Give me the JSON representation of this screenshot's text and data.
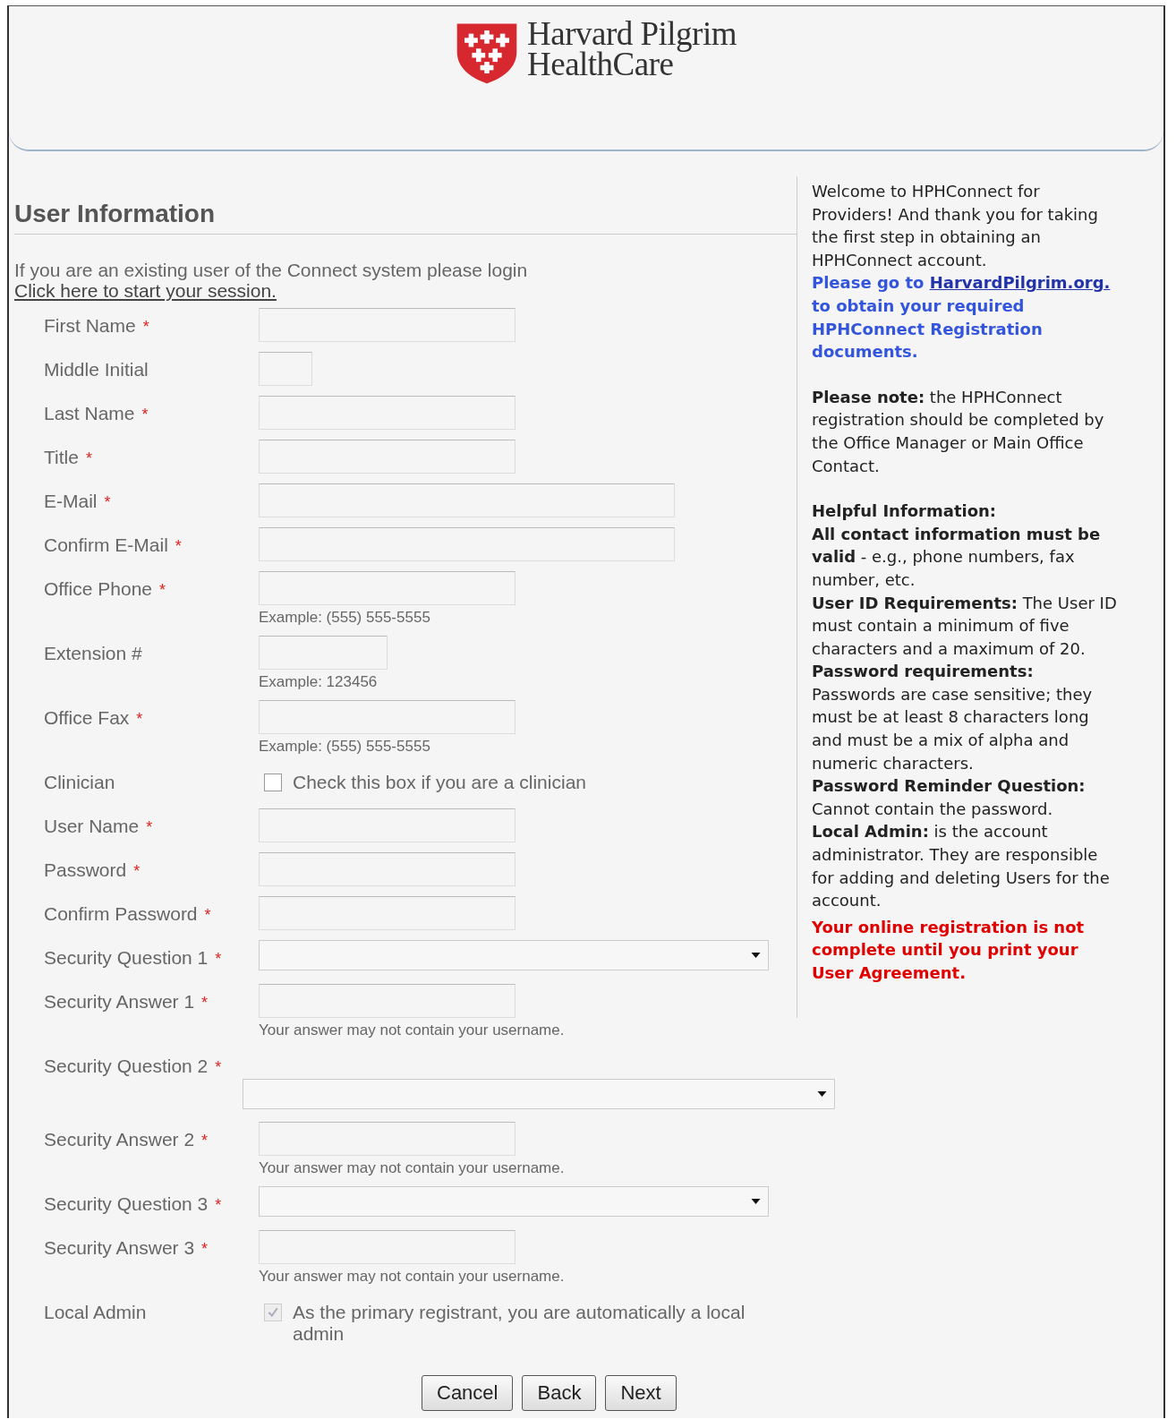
{
  "header": {
    "logo_lines": [
      "Harvard Pilgrim",
      "HealthCare"
    ]
  },
  "form": {
    "title": "User Information",
    "intro": {
      "text": "If you are an existing user of the Connect system please login",
      "link": "Click here to start your session."
    },
    "fields": [
      {
        "label": "First Name",
        "marker": "*",
        "kind": "text"
      },
      {
        "label": "Middle Initial",
        "kind": "text"
      },
      {
        "label": "Last Name",
        "marker": "*",
        "kind": "text"
      },
      {
        "label": "Title",
        "marker": "*",
        "kind": "text"
      },
      {
        "label": "E-Mail",
        "marker": "*",
        "kind": "text"
      },
      {
        "label": "Confirm E-Mail",
        "marker": "*",
        "kind": "text"
      },
      {
        "label": "Office Phone",
        "marker": "*",
        "kind": "text",
        "hint": "Example: (555) 555-5555"
      },
      {
        "label": "Extension #",
        "kind": "text",
        "hint": "Example: 123456"
      },
      {
        "label": "Office Fax",
        "marker": "*",
        "kind": "text",
        "hint": "Example: (555) 555-5555"
      },
      {
        "label": "Clinician",
        "kind": "checkbox",
        "text": "Check this box if you are a clinician",
        "checked": false,
        "disabled": false
      },
      {
        "label": "User Name",
        "marker": "*",
        "kind": "text"
      },
      {
        "label": "Password",
        "marker": "*",
        "kind": "text"
      },
      {
        "label": "Confirm Password",
        "marker": "*",
        "kind": "text"
      },
      {
        "label": "Security Question 1",
        "marker": "*",
        "kind": "select"
      },
      {
        "label": "Security Answer 1",
        "marker": "*",
        "kind": "text",
        "hint": "Your answer may not contain your username."
      },
      {
        "label": "Security Question 2",
        "marker": "*",
        "kind": "select"
      },
      {
        "label": "Security Answer 2",
        "marker": "*",
        "kind": "text",
        "hint": "Your answer may not contain your username."
      },
      {
        "label": "Security Question 3",
        "marker": "*",
        "kind": "select"
      },
      {
        "label": "Security Answer 3",
        "marker": "*",
        "kind": "text",
        "hint": "Your answer may not contain your username."
      },
      {
        "label": "Local Admin",
        "kind": "checkbox",
        "text": "As the primary registrant, you are automatically a local admin",
        "checked": true,
        "disabled": true
      }
    ],
    "buttons": [
      "Cancel",
      "Back",
      "Next"
    ]
  },
  "sidebar": {
    "blocks": [
      {
        "kind": "text",
        "text": "Welcome to HPHConnect for Providers! And thank you for taking the first step in obtaining an HPHConnect account."
      },
      {
        "kind": "link",
        "before": "Please go to",
        "link": "HarvardPilgrim.org.",
        "after": "to obtain your required HPHConnect Registration documents."
      },
      {
        "kind": "note",
        "text": "**Please note:**  the HPHConnect registration should be completed by the Office Manager or Main Office Contact."
      },
      {
        "kind": "heading",
        "text": "Helpful Information:"
      },
      {
        "kind": "text",
        "text": "**All contact information must be valid**  - e.g., phone numbers, fax number, etc."
      },
      {
        "kind": "text",
        "text": "**User ID Requirements:**  The User ID must contain a minimum of five characters and a maximum of 20."
      },
      {
        "kind": "text",
        "text": "**Password requirements:**  Passwords are case sensitive; they must be at least 8 characters long and must be a mix of alpha and numeric characters."
      },
      {
        "kind": "text",
        "text": "**Password Reminder Question:**  Cannot contain the password."
      },
      {
        "kind": "text",
        "text": "**Local Admin:**  is the account administrator. They are responsible for adding and deleting Users for the account."
      },
      {
        "kind": "warning",
        "text": "Your online registration is not complete until you print your User Agreement."
      }
    ]
  }
}
